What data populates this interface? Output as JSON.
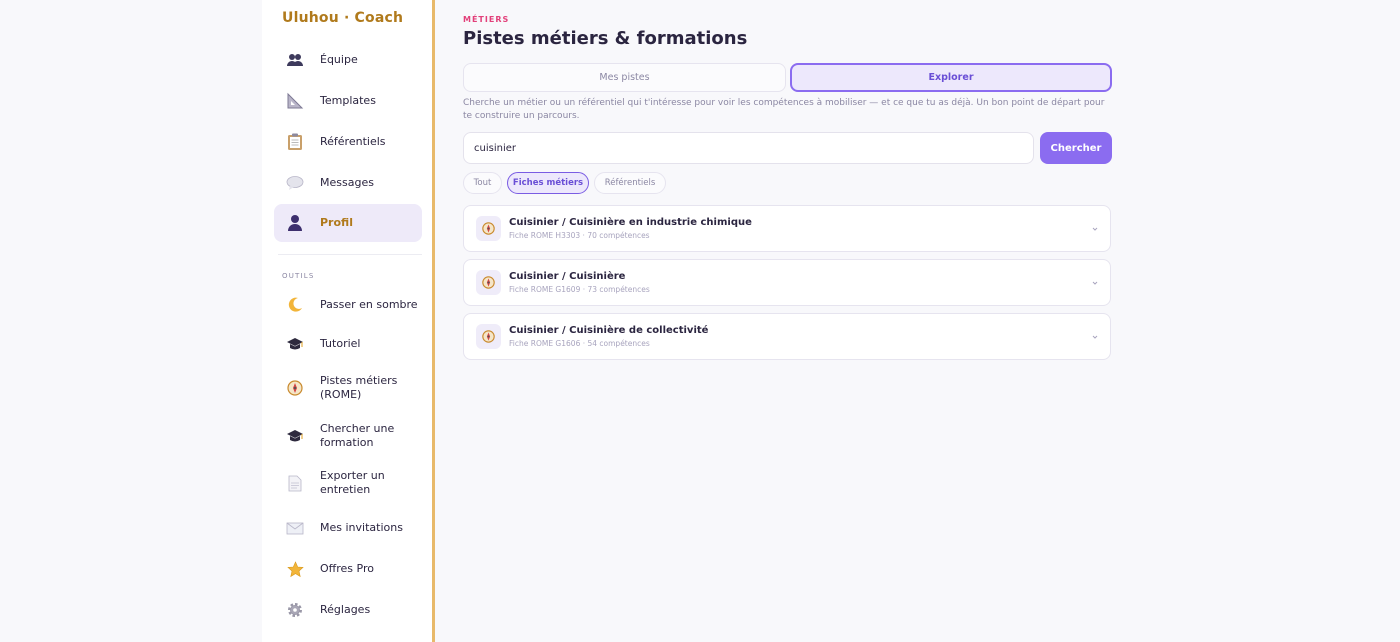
{
  "app": {
    "brand": "Uluhou · Coach"
  },
  "sidebar": {
    "items": [
      {
        "label": "Équipe",
        "icon": "team-icon"
      },
      {
        "label": "Templates",
        "icon": "ruler-triangle-icon"
      },
      {
        "label": "Référentiels",
        "icon": "clipboard-icon"
      },
      {
        "label": "Messages",
        "icon": "speech-bubble-icon"
      },
      {
        "label": "Profil",
        "icon": "user-icon",
        "active": true
      }
    ],
    "tools_label": "OUTILS",
    "tools": [
      {
        "label": "Passer en sombre",
        "icon": "moon-icon"
      },
      {
        "label": "Tutoriel",
        "icon": "graduation-cap-icon"
      },
      {
        "label": "Pistes métiers (ROME)",
        "icon": "compass-icon"
      },
      {
        "label": "Chercher une formation",
        "icon": "graduation-cap-icon"
      },
      {
        "label": "Exporter un entretien",
        "icon": "document-icon"
      },
      {
        "label": "Mes invitations",
        "icon": "envelope-icon"
      },
      {
        "label": "Offres Pro",
        "icon": "star-icon"
      },
      {
        "label": "Réglages",
        "icon": "gear-icon"
      }
    ]
  },
  "main": {
    "kicker": "MÉTIERS",
    "title": "Pistes métiers & formations",
    "tabs": [
      {
        "label": "Mes pistes",
        "active": false
      },
      {
        "label": "Explorer",
        "active": true
      }
    ],
    "description": "Cherche un métier ou un référentiel qui t'intéresse pour voir les compétences à mobiliser — et ce que tu as déjà. Un bon point de départ pour te construire un parcours.",
    "search": {
      "value": "cuisinier",
      "button_label": "Chercher"
    },
    "filters": [
      {
        "label": "Tout",
        "active": false
      },
      {
        "label": "Fiches métiers",
        "active": true
      },
      {
        "label": "Référentiels",
        "active": false
      }
    ],
    "results": [
      {
        "title": "Cuisinier / Cuisinière en industrie chimique",
        "subtitle": "Fiche ROME H3303 · 70 compétences",
        "icon": "compass-icon"
      },
      {
        "title": "Cuisinier / Cuisinière",
        "subtitle": "Fiche ROME G1609 · 73 compétences",
        "icon": "compass-icon"
      },
      {
        "title": "Cuisinier / Cuisinière de collectivité",
        "subtitle": "Fiche ROME G1606 · 54 compétences",
        "icon": "compass-icon"
      }
    ]
  },
  "colors": {
    "accent": "#8b6cf0",
    "brand": "#b07a1c",
    "kicker": "#e2407a",
    "sidebar_border": "#e8b96a"
  }
}
